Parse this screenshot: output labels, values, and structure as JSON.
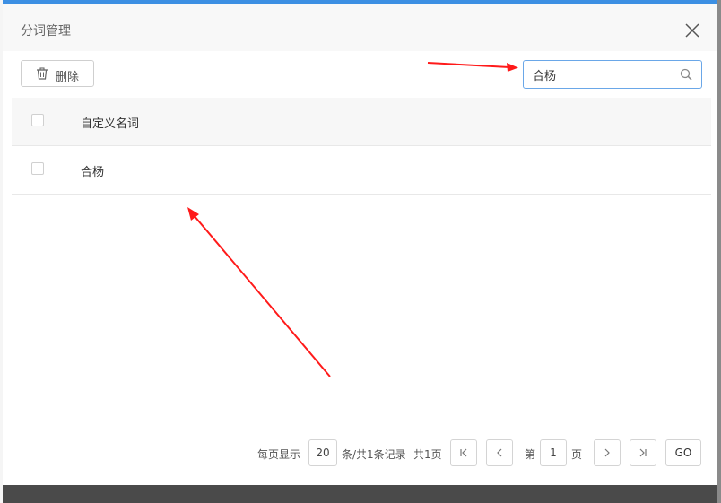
{
  "dialog": {
    "title": "分词管理"
  },
  "toolbar": {
    "delete_label": "删除",
    "search_value": "合杨"
  },
  "table": {
    "columns": [
      "自定义名词"
    ],
    "rows": [
      {
        "term": "合杨"
      }
    ]
  },
  "pagination": {
    "per_page_label": "每页显示",
    "per_page_value": "20",
    "records_text": "条/共1条记录",
    "pages_text": "共1页",
    "page_prefix": "第",
    "page_value": "1",
    "page_suffix": "页",
    "go_label": "GO"
  },
  "colors": {
    "accent": "#3c8fe3",
    "annotation_arrow": "#ff1a1a"
  }
}
